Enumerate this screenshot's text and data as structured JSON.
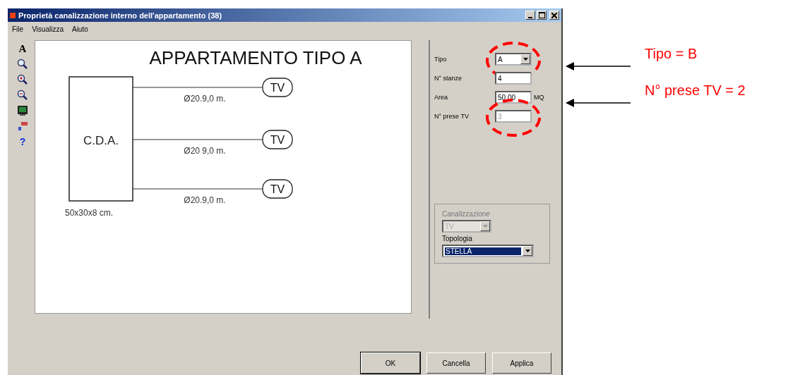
{
  "window": {
    "title": "Proprietà canalizzazione interno dell'appartamento (38)"
  },
  "menu": [
    {
      "label": "File"
    },
    {
      "label": "Visualizza"
    },
    {
      "label": "Aiuto"
    }
  ],
  "toolbar": [
    {
      "kind": "text",
      "label": "A"
    },
    {
      "kind": "zoom"
    },
    {
      "kind": "zoom-in"
    },
    {
      "kind": "zoom-out"
    },
    {
      "kind": "monitor"
    },
    {
      "kind": "paint"
    },
    {
      "kind": "help",
      "label": "?"
    }
  ],
  "diagram": {
    "title": "APPARTAMENTO TIPO A",
    "box_label": "C.D.A.",
    "box_size": "50x30x8 cm.",
    "branches": [
      {
        "cable": "Ø20.9,0 m.",
        "outlet": "TV"
      },
      {
        "cable": "Ø20 9,0 m.",
        "outlet": "TV"
      },
      {
        "cable": "Ø20.9,0 m.",
        "outlet": "TV"
      }
    ]
  },
  "fields": [
    {
      "label": "Tipo",
      "kind": "dropdown",
      "value": "A",
      "highlighted": true
    },
    {
      "label": "N° stanze",
      "kind": "text",
      "value": "4",
      "highlighted": false
    },
    {
      "label": "Area",
      "kind": "text",
      "value": "50,00",
      "unit": "MQ",
      "highlighted": false
    },
    {
      "label": "N° prese TV",
      "kind": "text",
      "value": "3",
      "disabled": true,
      "highlighted": true
    }
  ],
  "group": [
    {
      "label": "Canalizzazione",
      "value": "TV",
      "disabled": true,
      "selected": false
    },
    {
      "label": "Topologia",
      "value": "STELLA",
      "disabled": false,
      "selected": true
    }
  ],
  "buttons": [
    {
      "label": "OK",
      "default": true
    },
    {
      "label": "Cancella",
      "default": false
    },
    {
      "label": "Applica",
      "default": false
    }
  ],
  "callouts": [
    {
      "text": "Tipo = B"
    },
    {
      "text": "N° prese TV = 2"
    }
  ]
}
